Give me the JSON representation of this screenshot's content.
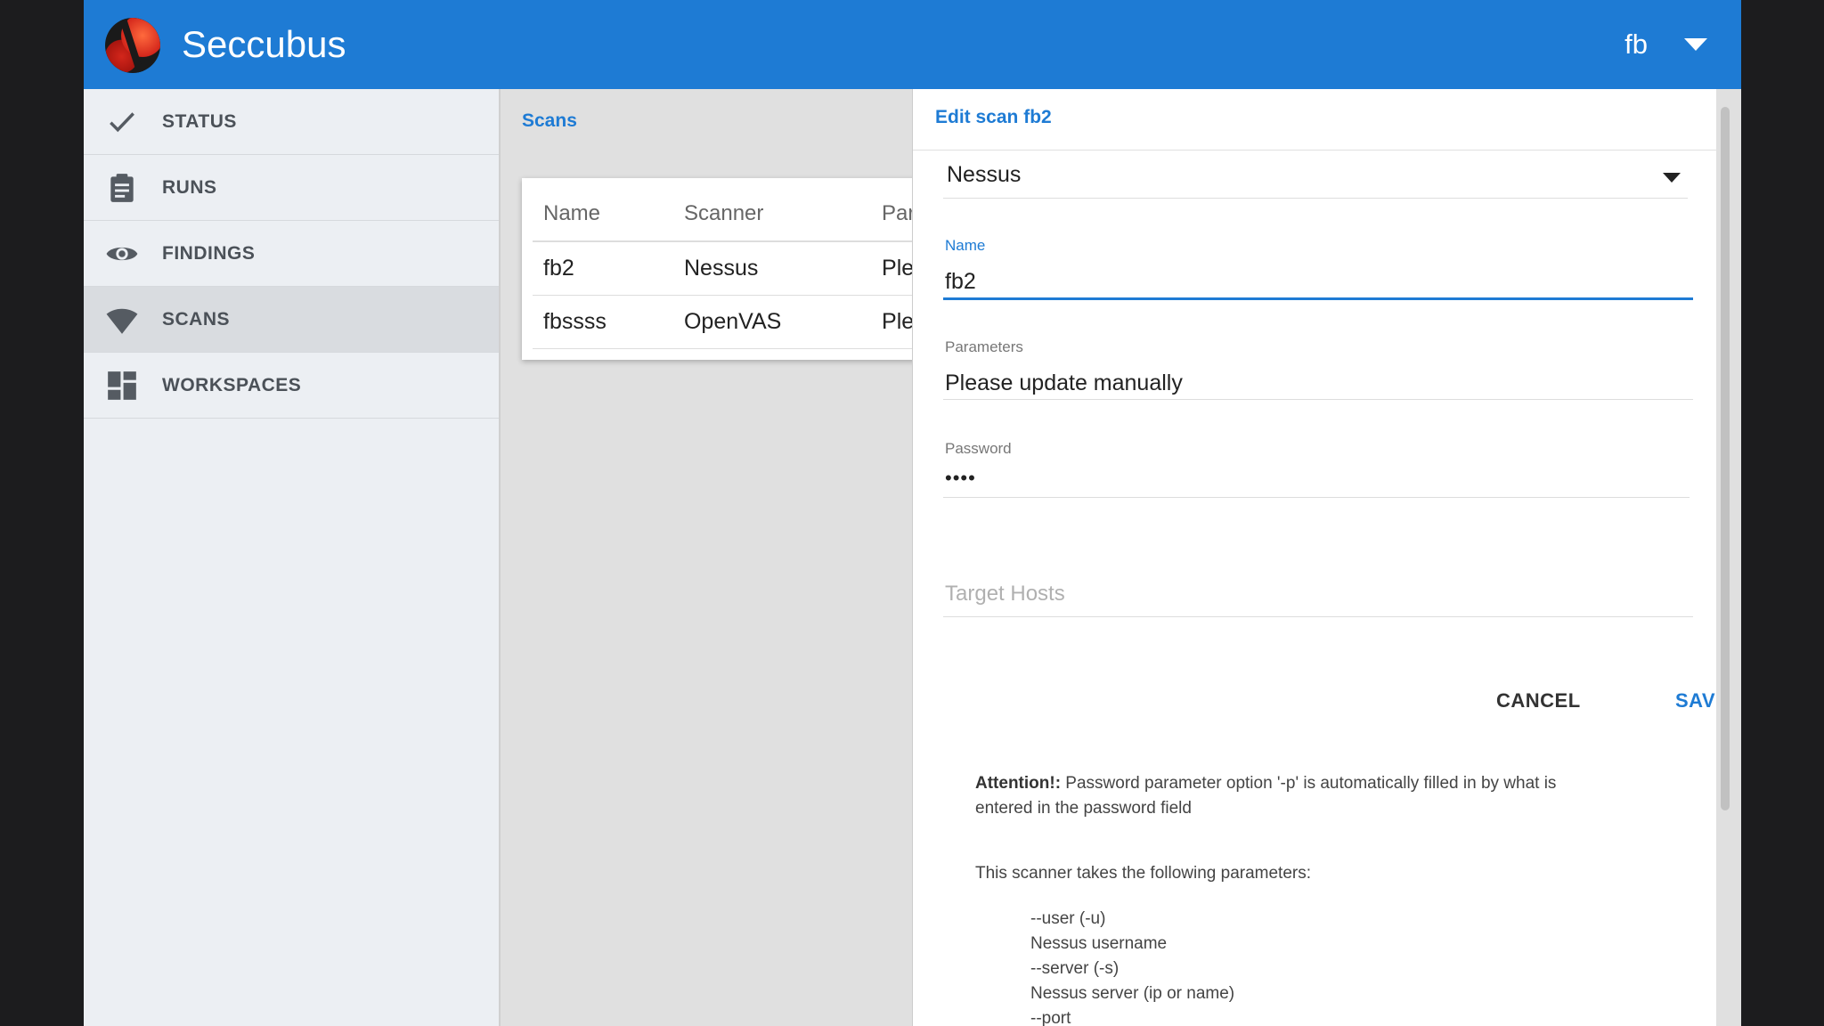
{
  "header": {
    "app_title": "Seccubus",
    "user": "fb"
  },
  "sidebar": {
    "items": [
      {
        "label": "STATUS",
        "icon": "check-icon"
      },
      {
        "label": "RUNS",
        "icon": "clipboard-icon"
      },
      {
        "label": "FINDINGS",
        "icon": "eye-icon"
      },
      {
        "label": "SCANS",
        "icon": "wifi-icon",
        "active": true
      },
      {
        "label": "WORKSPACES",
        "icon": "dashboard-icon"
      }
    ]
  },
  "main": {
    "breadcrumb": "Scans",
    "table": {
      "columns": [
        "Name",
        "Scanner",
        "Parame"
      ],
      "rows": [
        [
          "fb2",
          "Nessus",
          "Please"
        ],
        [
          "fbssss",
          "OpenVAS",
          "Please"
        ]
      ]
    }
  },
  "edit_panel": {
    "title": "Edit scan fb2",
    "scanner_select": "Nessus",
    "name": {
      "label": "Name",
      "value": "fb2"
    },
    "parameters": {
      "label": "Parameters",
      "value": "Please update manually"
    },
    "password": {
      "label": "Password",
      "value": "••••"
    },
    "target_hosts": {
      "placeholder": "Target Hosts"
    },
    "cancel_label": "CANCEL",
    "save_label": "SAVE",
    "attention_bold": "Attention!:",
    "attention_text": " Password parameter option '-p' is automatically filled in by what is entered in the password field",
    "params_intro": "This scanner takes the following parameters:",
    "params": [
      "--user (-u)",
      "Nessus username",
      "--server (-s)",
      "Nessus server (ip or name)",
      "--port"
    ]
  },
  "colors": {
    "accent": "#1e7bd4",
    "sidebar_bg": "#eceff3",
    "content_bg": "#e0e0e0"
  }
}
